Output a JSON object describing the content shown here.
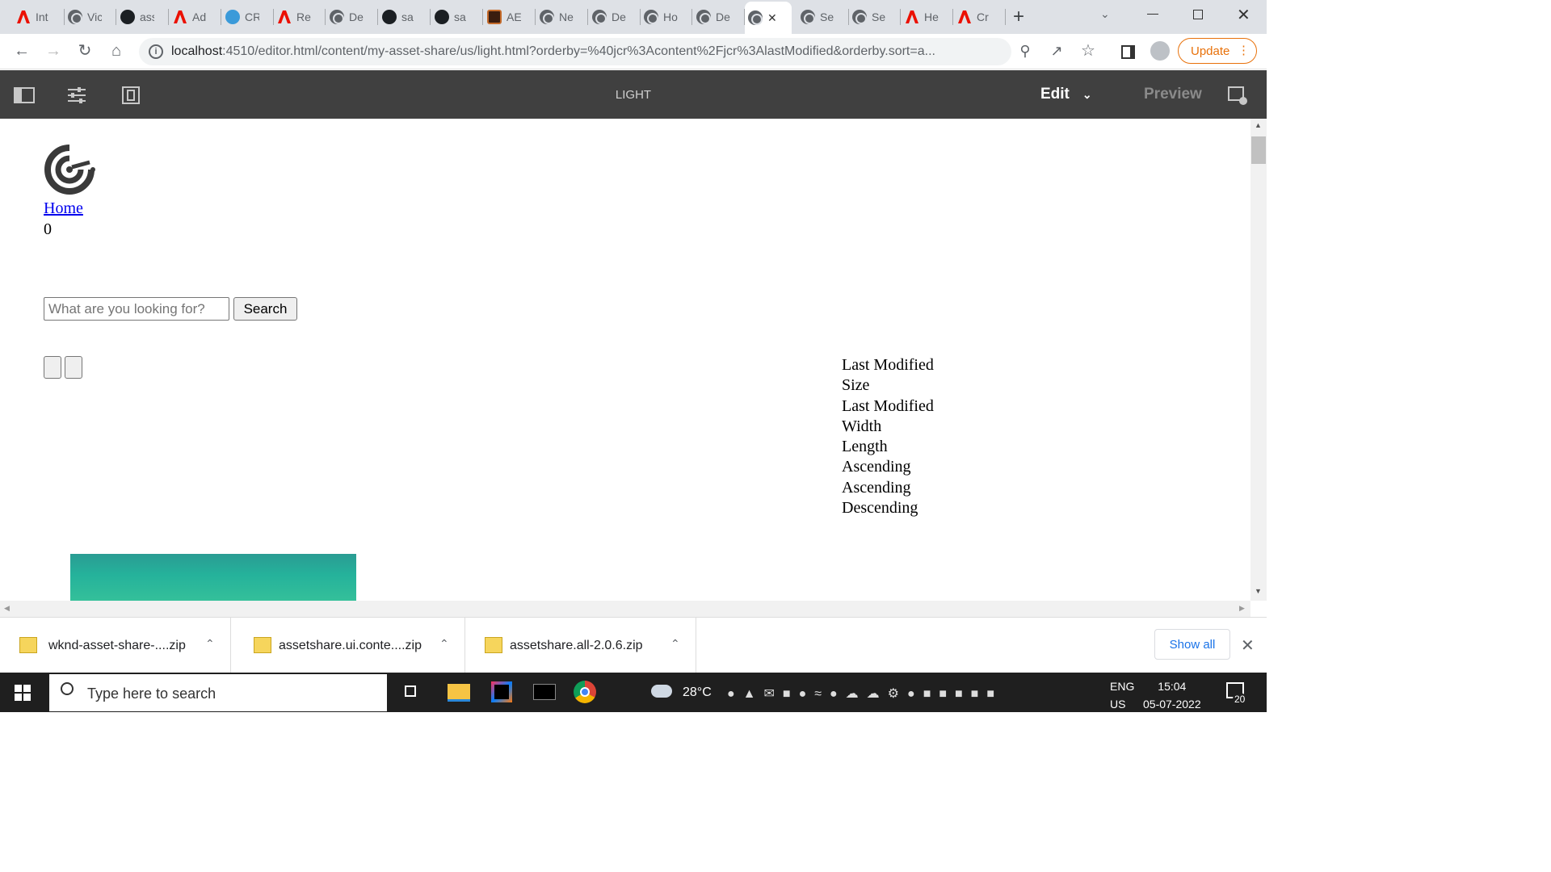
{
  "browser": {
    "tabs": [
      {
        "label": "Int",
        "icon": "adobe-icon"
      },
      {
        "label": "Vic",
        "icon": "globe-icon"
      },
      {
        "label": "ass",
        "icon": "github-icon"
      },
      {
        "label": "Ad",
        "icon": "adobe-icon"
      },
      {
        "label": "CR",
        "icon": "cr-icon"
      },
      {
        "label": "Re",
        "icon": "adobe-icon"
      },
      {
        "label": "De",
        "icon": "globe-icon"
      },
      {
        "label": "sa",
        "icon": "github-icon"
      },
      {
        "label": "sa",
        "icon": "github-icon"
      },
      {
        "label": "AE",
        "icon": "aem-icon"
      },
      {
        "label": "Ne",
        "icon": "globe-icon"
      },
      {
        "label": "De",
        "icon": "globe-icon"
      },
      {
        "label": "Ho",
        "icon": "globe-icon"
      },
      {
        "label": "De",
        "icon": "globe-icon"
      },
      {
        "label": "",
        "icon": "globe-icon",
        "active": true
      },
      {
        "label": "Se",
        "icon": "globe-icon"
      },
      {
        "label": "Se",
        "icon": "globe-icon"
      },
      {
        "label": "He",
        "icon": "adobe-icon"
      },
      {
        "label": "Cr",
        "icon": "adobe-icon"
      }
    ],
    "new_tab": "+",
    "url_host": "localhost",
    "url_rest": ":4510/editor.html/content/my-asset-share/us/light.html?orderby=%40jcr%3Acontent%2Fjcr%3AlastModified&orderby.sort=a...",
    "update_label": "Update"
  },
  "aem": {
    "page_title": "LIGHT",
    "edit_label": "Edit",
    "preview_label": "Preview"
  },
  "page": {
    "home_link": "Home",
    "count": "0",
    "search_placeholder": "What are you looking for?",
    "search_button": "Search",
    "sort_options": [
      "Last Modified",
      "Size",
      "Last Modified",
      "Width",
      "Length",
      "Ascending",
      "Ascending",
      "Descending"
    ]
  },
  "downloads": {
    "items": [
      {
        "name": "wknd-asset-share-....zip"
      },
      {
        "name": "assetshare.ui.conte....zip"
      },
      {
        "name": "assetshare.all-2.0.6.zip"
      }
    ],
    "show_all": "Show all"
  },
  "taskbar": {
    "search_placeholder": "Type here to search",
    "temperature": "28°C",
    "lang_top": "ENG",
    "lang_bottom": "US",
    "time": "15:04",
    "date": "05-07-2022",
    "notification_count": "20"
  }
}
